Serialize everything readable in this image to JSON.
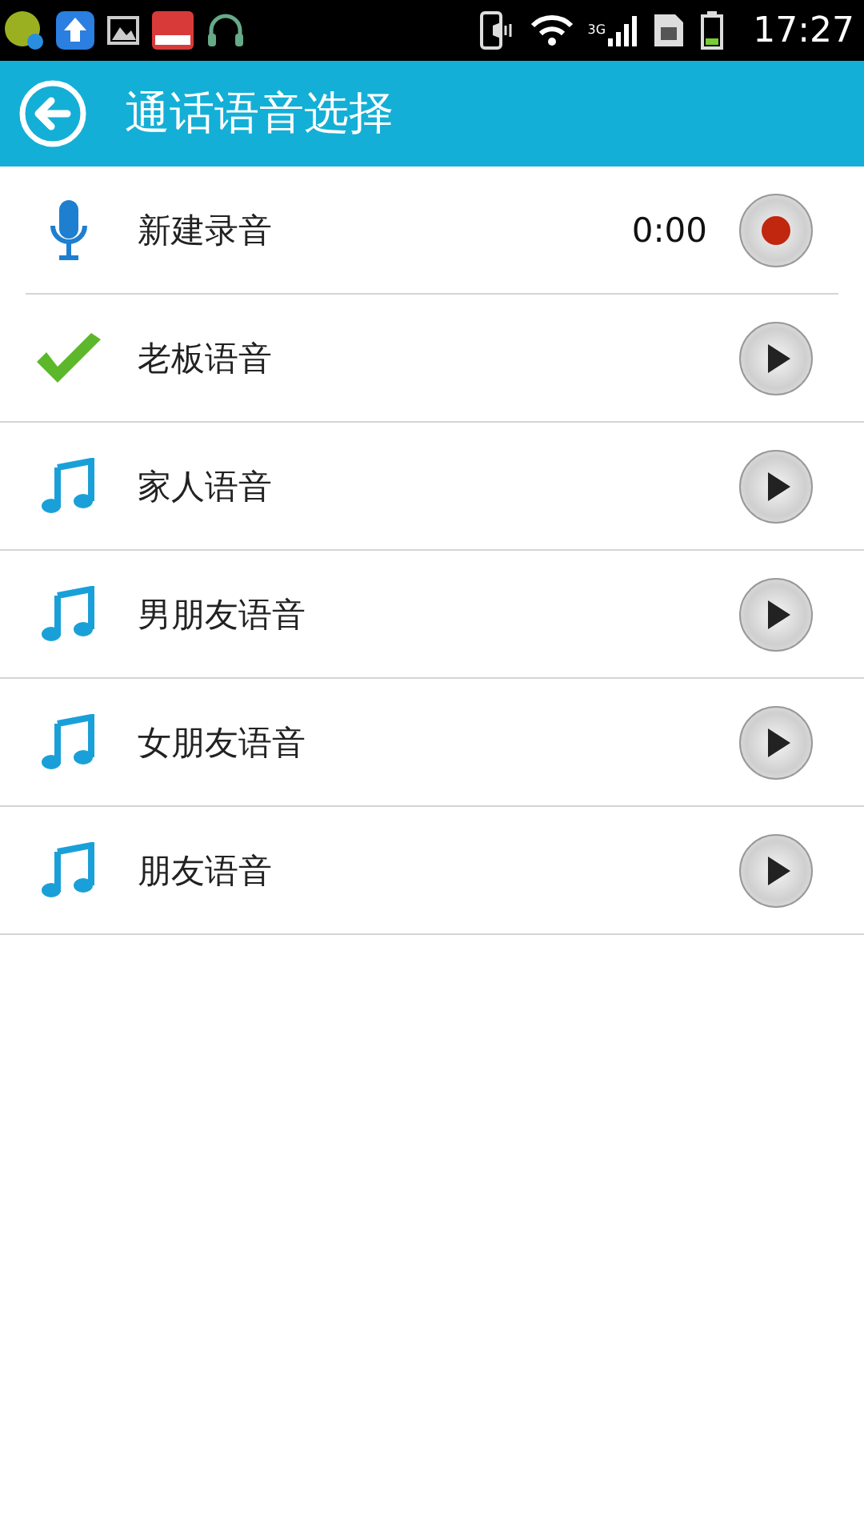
{
  "status_bar": {
    "network": "3G",
    "time": "17:27"
  },
  "header": {
    "title": "通话语音选择"
  },
  "recording": {
    "label": "新建录音",
    "time": "0:00"
  },
  "voices": [
    {
      "label": "老板语音",
      "selected": true
    },
    {
      "label": "家人语音",
      "selected": false
    },
    {
      "label": "男朋友语音",
      "selected": false
    },
    {
      "label": "女朋友语音",
      "selected": false
    },
    {
      "label": "朋友语音",
      "selected": false
    }
  ]
}
